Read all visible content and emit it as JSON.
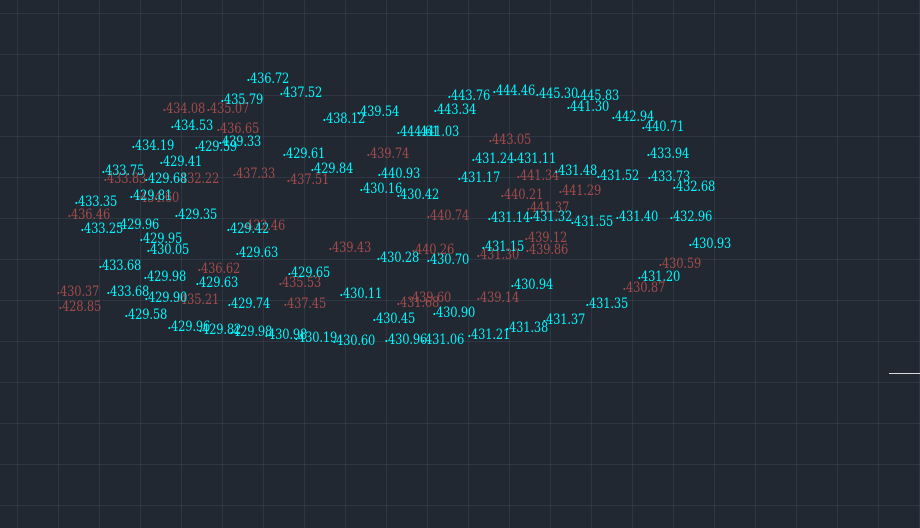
{
  "colors": {
    "background": "#212831",
    "cyan_labels": "#00f7ff",
    "red_labels": "#a34b4b"
  },
  "cyan_points": [
    "436.72",
    "437.52",
    "435.79",
    "434.53",
    "438.12",
    "439.54",
    "443.76",
    "444.46",
    "445.30",
    "445.83",
    "443.34",
    "441.30",
    "442.94",
    "440.71",
    "444.61",
    "441.03",
    "439.33",
    "434.19",
    "429.41",
    "429.59",
    "429.61",
    "429.84",
    "433.75",
    "429.68",
    "431.24",
    "431.11",
    "431.48",
    "431.52",
    "431.17",
    "433.94",
    "433.73",
    "432.68",
    "433.35",
    "429.81",
    "430.42",
    "432.96",
    "431.14",
    "431.32",
    "431.55",
    "431.40",
    "429.35",
    "429.42",
    "433.25",
    "429.95",
    "430.05",
    "431.15",
    "430.93",
    "429.63",
    "430.28",
    "430.70",
    "433.68",
    "429.98",
    "429.63",
    "429.65",
    "431.20",
    "430.94",
    "433.68",
    "429.90",
    "431.35",
    "429.74",
    "429.58",
    "429.96",
    "430.11",
    "430.45",
    "430.90",
    "431.37",
    "431.38",
    "429.82",
    "429.98",
    "430.98",
    "430.19",
    "430.60",
    "430.96",
    "431.06",
    "431.21",
    "430.16",
    "440.93",
    "429.96"
  ],
  "red_points": [
    "434.08",
    "435.07",
    "436.65",
    "443.05",
    "439.74",
    "437.33",
    "437.51",
    "432.22",
    "433.83",
    "434.60",
    "432.46",
    "441.34",
    "440.21",
    "441.37",
    "441.29",
    "439.43",
    "440.26",
    "439.12",
    "436.62",
    "430.59",
    "430.87",
    "435.53",
    "439.14",
    "439.60",
    "430.37",
    "435.21",
    "428.85",
    "437.45",
    "431.68",
    "440.74",
    "436.46",
    "431.30",
    "439.86"
  ]
}
